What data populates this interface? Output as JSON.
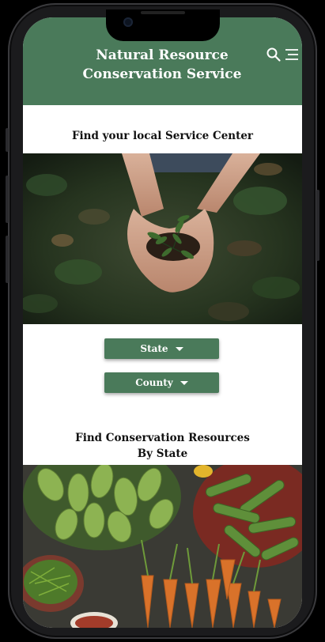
{
  "header": {
    "title_line1": "Natural Resource",
    "title_line2": "Conservation Service",
    "search_icon": "search-icon",
    "menu_icon": "hamburger-menu-icon"
  },
  "service_center": {
    "heading": "Find your local Service Center",
    "image": "hands-holding-seedling-photo"
  },
  "filters": {
    "state_label": "State",
    "county_label": "County"
  },
  "resources": {
    "heading_line1": "Find Conservation Resources",
    "heading_line2": "By State",
    "image": "vegetables-market-photo"
  },
  "colors": {
    "brand_green": "#4a7a5a",
    "text_dark": "#111111",
    "background": "#ffffff"
  }
}
